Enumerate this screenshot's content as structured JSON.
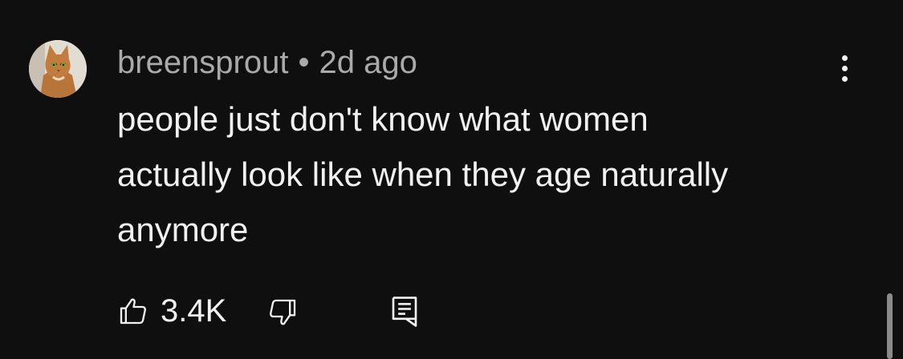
{
  "comment": {
    "author": "breensprout",
    "separator": "•",
    "timestamp": "2d ago",
    "text": "people just don't know what women\nactually look like when they age naturally\nanymore",
    "likes": "3.4K",
    "avatar_icon": "cat-avatar"
  },
  "icons": {
    "menu": "more-vert-icon",
    "like": "thumbs-up-icon",
    "dislike": "thumbs-down-icon",
    "reply": "reply-comment-icon"
  },
  "colors": {
    "background": "#0f0f0f",
    "text": "#f1f1f1",
    "meta": "#aaaaaa"
  }
}
